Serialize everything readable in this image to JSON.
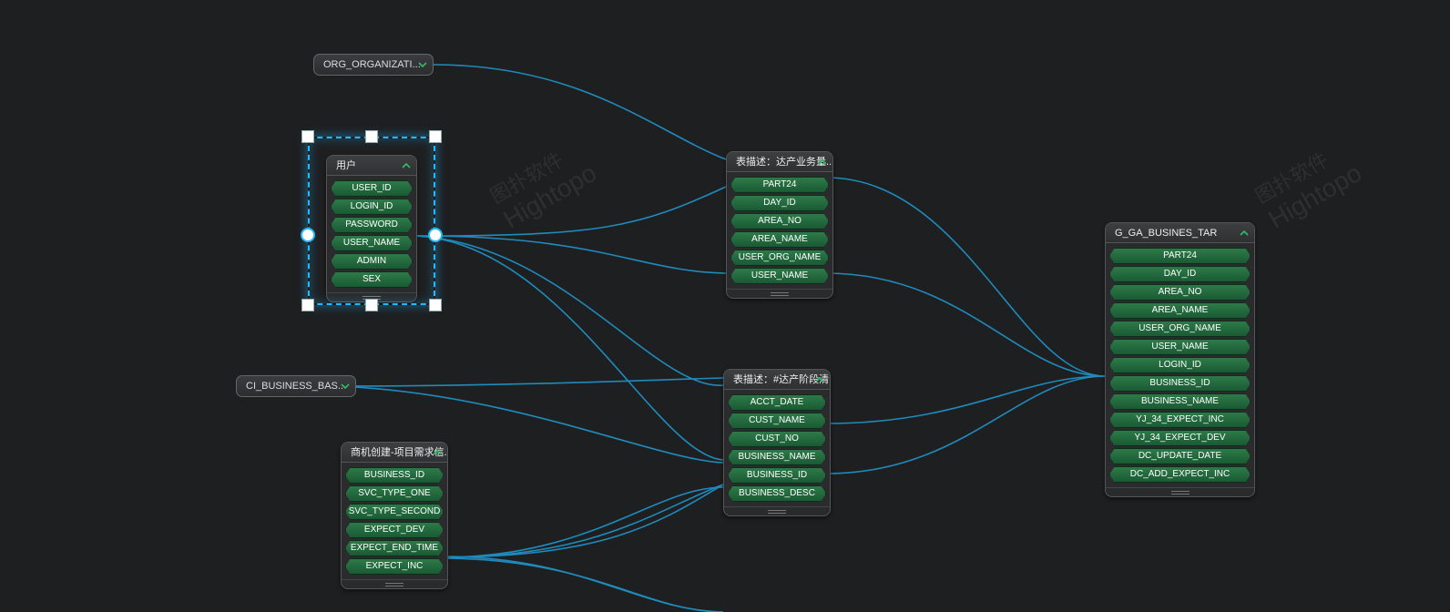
{
  "watermark": {
    "en": "Hightopo",
    "cn": "图扑软件"
  },
  "nodes": {
    "org": {
      "title": "ORG_ORGANIZATI..."
    },
    "ci": {
      "title": "CI_BUSINESS_BAS.."
    },
    "user": {
      "title": "用户",
      "fields": [
        "USER_ID",
        "LOGIN_ID",
        "PASSWORD",
        "USER_NAME",
        "ADMIN",
        "SEX"
      ]
    },
    "desc1": {
      "title": "表描述：达产业务量..",
      "fields": [
        "PART24",
        "DAY_ID",
        "AREA_NO",
        "AREA_NAME",
        "USER_ORG_NAME",
        "USER_NAME"
      ]
    },
    "desc2": {
      "title": "表描述：#达产阶段清..",
      "fields": [
        "ACCT_DATE",
        "CUST_NAME",
        "CUST_NO",
        "BUSINESS_NAME",
        "BUSINESS_ID",
        "BUSINESS_DESC"
      ]
    },
    "biz": {
      "title": "商机创建-项目需求信..",
      "fields": [
        "BUSINESS_ID",
        "SVC_TYPE_ONE",
        "SVC_TYPE_SECOND",
        "EXPECT_DEV",
        "EXPECT_END_TIME",
        "EXPECT_INC"
      ]
    },
    "target": {
      "title": "G_GA_BUSINES_TAR",
      "fields": [
        "PART24",
        "DAY_ID",
        "AREA_NO",
        "AREA_NAME",
        "USER_ORG_NAME",
        "USER_NAME",
        "LOGIN_ID",
        "BUSINESS_ID",
        "BUSINESS_NAME",
        "YJ_34_EXPECT_INC",
        "YJ_34_EXPECT_DEV",
        "DC_UPDATE_DATE",
        "DC_ADD_EXPECT_INC"
      ]
    }
  }
}
